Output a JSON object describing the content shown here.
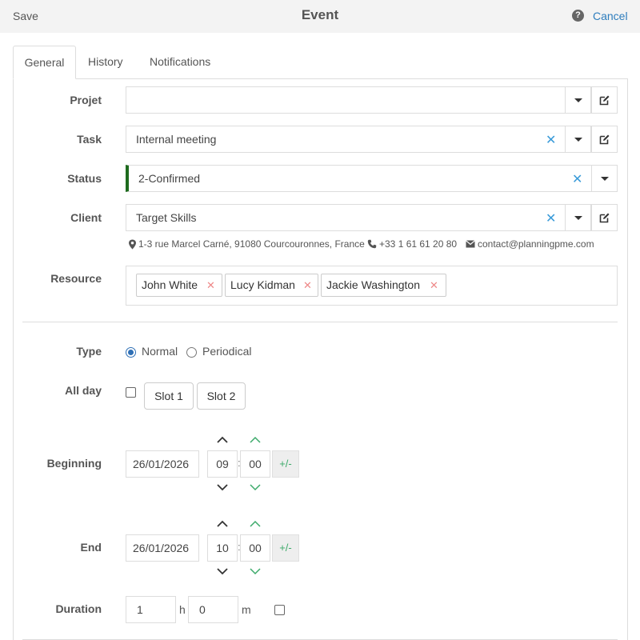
{
  "header": {
    "save_label": "Save",
    "title": "Event",
    "help_label": "?",
    "cancel_label": "Cancel"
  },
  "tabs": [
    {
      "label": "General",
      "active": true
    },
    {
      "label": "History",
      "active": false
    },
    {
      "label": "Notifications",
      "active": false
    }
  ],
  "form": {
    "projet": {
      "label": "Projet",
      "value": ""
    },
    "task": {
      "label": "Task",
      "value": "Internal meeting"
    },
    "status": {
      "label": "Status",
      "value": "2-Confirmed",
      "color": "#1e6b1e"
    },
    "client": {
      "label": "Client",
      "value": "Target Skills",
      "address": "1-3 rue Marcel Carné, 91080 Courcouronnes, France",
      "phone": "+33 1 61 61 20 80",
      "email": "contact@planningpme.com"
    },
    "resource": {
      "label": "Resource",
      "items": [
        "John White",
        "Lucy Kidman",
        "Jackie Washington"
      ]
    },
    "type": {
      "label": "Type",
      "options": [
        "Normal",
        "Periodical"
      ],
      "selected": "Normal"
    },
    "all_day": {
      "label": "All day",
      "checked": false,
      "slot1": "Slot 1",
      "slot2": "Slot 2"
    },
    "beginning": {
      "label": "Beginning",
      "date": "26/01/2026",
      "hour": "09",
      "minute": "00",
      "plusminus": "+/-"
    },
    "end": {
      "label": "End",
      "date": "26/01/2026",
      "hour": "10",
      "minute": "00",
      "plusminus": "+/-"
    },
    "duration": {
      "label": "Duration",
      "hours": "1",
      "hours_unit": "h",
      "minutes": "0",
      "minutes_unit": "m",
      "checked": false
    }
  },
  "colors": {
    "accent_blue": "#2e7dbd",
    "accent_green": "#3caa6a",
    "status_bar": "#1e6b1e"
  }
}
